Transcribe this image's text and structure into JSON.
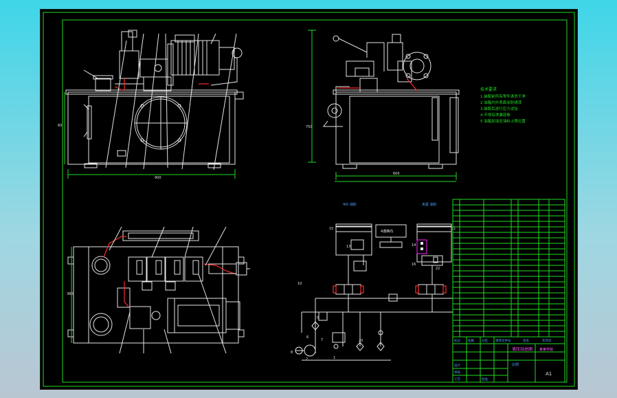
{
  "sheet": {
    "dimension_front_width": "900",
    "dimension_front_height": "60",
    "dimension_side_width": "600",
    "dimension_side_height": "750",
    "dimension_top_height": "380"
  },
  "notes": {
    "heading": "技术要求",
    "lines": [
      "1.装配前所有零件清洗干净",
      "2.油箱内外表面涂防锈漆",
      "3.装配后进行压力试验",
      "4.不得有渗漏现象",
      "5.油箱加油至油标上限位置"
    ]
  },
  "schematic": {
    "label_left_cylinder": "40t  油缸",
    "label_right_cylinder": "夹紧  油缸",
    "label_box": "4通换向",
    "callouts": [
      "10",
      "15",
      "11",
      "13",
      "14",
      "2",
      "5",
      "6",
      "7",
      "8",
      "9",
      "20",
      "1",
      "21",
      "22",
      "16"
    ]
  },
  "title_block": {
    "drawing_title": "液压站总图",
    "company": "某某学院",
    "drawing_number": "A1",
    "scale_label": "比例",
    "row_labels": [
      "标记",
      "处数",
      "分区",
      "更改文件号",
      "签名",
      "年月日"
    ],
    "role_labels": [
      "设计",
      "审核",
      "工艺",
      "批准"
    ]
  },
  "colors": {
    "frame": "#22dd22",
    "line": "#e6e6e6",
    "accent_red": "#ff2a2a",
    "accent_magenta": "#ff22ff",
    "note_text": "#22dd22",
    "table_text": "#4da3ff"
  }
}
